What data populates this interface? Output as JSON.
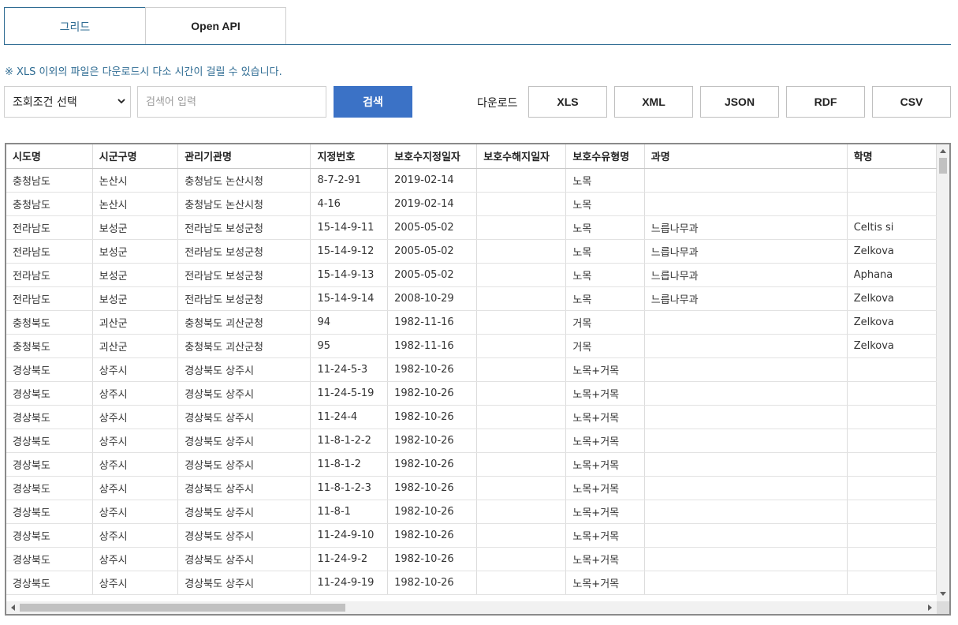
{
  "tabs": [
    {
      "label": "그리드",
      "active": true
    },
    {
      "label": "Open API",
      "active": false
    }
  ],
  "notice": "※ XLS 이외의 파일은 다운로드시 다소 시간이 걸릴 수 있습니다.",
  "search": {
    "select_value": "조회조건 선택",
    "placeholder": "검색어 입력",
    "button_label": "검색"
  },
  "download": {
    "label": "다운로드",
    "formats": [
      "XLS",
      "XML",
      "JSON",
      "RDF",
      "CSV"
    ]
  },
  "grid": {
    "columns": [
      "시도명",
      "시군구명",
      "관리기관명",
      "지정번호",
      "보호수지정일자",
      "보호수해지일자",
      "보호수유형명",
      "과명",
      "학명"
    ],
    "rows": [
      [
        "충청남도",
        "논산시",
        "충청남도 논산시청",
        "8-7-2-91",
        "2019-02-14",
        "",
        "노목",
        "",
        ""
      ],
      [
        "충청남도",
        "논산시",
        "충청남도 논산시청",
        "4-16",
        "2019-02-14",
        "",
        "노목",
        "",
        ""
      ],
      [
        "전라남도",
        "보성군",
        "전라남도 보성군청",
        "15-14-9-11",
        "2005-05-02",
        "",
        "노목",
        "느릅나무과",
        "Celtis si"
      ],
      [
        "전라남도",
        "보성군",
        "전라남도 보성군청",
        "15-14-9-12",
        "2005-05-02",
        "",
        "노목",
        "느릅나무과",
        "Zelkova"
      ],
      [
        "전라남도",
        "보성군",
        "전라남도 보성군청",
        "15-14-9-13",
        "2005-05-02",
        "",
        "노목",
        "느릅나무과",
        "Aphana"
      ],
      [
        "전라남도",
        "보성군",
        "전라남도 보성군청",
        "15-14-9-14",
        "2008-10-29",
        "",
        "노목",
        "느릅나무과",
        "Zelkova"
      ],
      [
        "충청북도",
        "괴산군",
        "충청북도 괴산군청",
        "94",
        "1982-11-16",
        "",
        "거목",
        "",
        "Zelkova"
      ],
      [
        "충청북도",
        "괴산군",
        "충청북도 괴산군청",
        "95",
        "1982-11-16",
        "",
        "거목",
        "",
        "Zelkova"
      ],
      [
        "경상북도",
        "상주시",
        "경상북도 상주시",
        "11-24-5-3",
        "1982-10-26",
        "",
        "노목+거목",
        "",
        ""
      ],
      [
        "경상북도",
        "상주시",
        "경상북도 상주시",
        "11-24-5-19",
        "1982-10-26",
        "",
        "노목+거목",
        "",
        ""
      ],
      [
        "경상북도",
        "상주시",
        "경상북도 상주시",
        "11-24-4",
        "1982-10-26",
        "",
        "노목+거목",
        "",
        ""
      ],
      [
        "경상북도",
        "상주시",
        "경상북도 상주시",
        "11-8-1-2-2",
        "1982-10-26",
        "",
        "노목+거목",
        "",
        ""
      ],
      [
        "경상북도",
        "상주시",
        "경상북도 상주시",
        "11-8-1-2",
        "1982-10-26",
        "",
        "노목+거목",
        "",
        ""
      ],
      [
        "경상북도",
        "상주시",
        "경상북도 상주시",
        "11-8-1-2-3",
        "1982-10-26",
        "",
        "노목+거목",
        "",
        ""
      ],
      [
        "경상북도",
        "상주시",
        "경상북도 상주시",
        "11-8-1",
        "1982-10-26",
        "",
        "노목+거목",
        "",
        ""
      ],
      [
        "경상북도",
        "상주시",
        "경상북도 상주시",
        "11-24-9-10",
        "1982-10-26",
        "",
        "노목+거목",
        "",
        ""
      ],
      [
        "경상북도",
        "상주시",
        "경상북도 상주시",
        "11-24-9-2",
        "1982-10-26",
        "",
        "노목+거목",
        "",
        ""
      ],
      [
        "경상북도",
        "상주시",
        "경상북도 상주시",
        "11-24-9-19",
        "1982-10-26",
        "",
        "노목+거목",
        "",
        ""
      ]
    ]
  },
  "colors": {
    "accent": "#2f6c93",
    "search_button": "#3b72c6"
  },
  "icons": {
    "select": "chevron-down-icon",
    "scroll_up": "arrow-up-icon",
    "scroll_down": "arrow-down-icon",
    "scroll_left": "arrow-left-icon",
    "scroll_right": "arrow-right-icon"
  }
}
